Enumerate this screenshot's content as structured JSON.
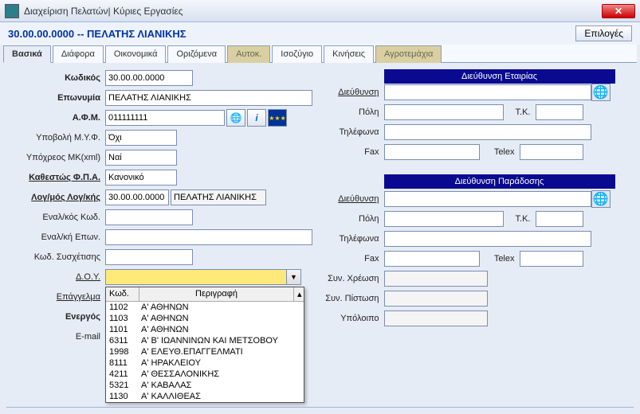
{
  "titlebar": {
    "text": "Διαχείριση Πελατών| Κύριες Εργασίες",
    "close": "✕"
  },
  "subheader": {
    "text": "30.00.00.0000 -- ΠΕΛΑΤΗΣ ΛΙΑΝΙΚΗΣ",
    "options": "Επιλογές"
  },
  "tabs": {
    "basic": "Βασικά",
    "misc": "Διάφορα",
    "finance": "Οικονομικά",
    "defs": "Οριζόμενα",
    "auto": "Αυτοκ.",
    "balance": "Ισοζύγιο",
    "moves": "Κινήσεις",
    "parcels": "Αγροτεμάχια"
  },
  "left": {
    "code_lbl": "Κωδικός",
    "code": "30.00.00.0000",
    "name_lbl": "Επωνυμία",
    "name": "ΠΕΛΑΤΗΣ ΛΙΑΝΙΚΗΣ",
    "afm_lbl": "Α.Φ.Μ.",
    "afm": "011111111",
    "myf_lbl": "Υποβολή Μ.Υ.Φ.",
    "myf": "Όχι",
    "mk_lbl": "Υπόχρεος MK(xml)",
    "mk": "Ναί",
    "vat_lbl": "Καθεστώς Φ.Π.Α.",
    "vat": "Κανονικό",
    "acct_lbl": "Λογ/μός Λογ/κής",
    "acct_code": "30.00.00.0000",
    "acct_name": "ΠΕΛΑΤΗΣ ΛΙΑΝΙΚΗΣ",
    "altcode_lbl": "Εναλ/κός Κωδ.",
    "altcode": "",
    "altname_lbl": "Εναλ/κή Επων.",
    "altname": "",
    "relation_lbl": "Κωδ. Συσχέτισης",
    "relation": "",
    "doy_lbl": "Δ.Ο.Υ.",
    "doy": "",
    "prof_lbl": "Επάγγελμα",
    "active_lbl": "Ενεργός",
    "email_lbl": "E-mail"
  },
  "right": {
    "company_hdr": "Διεύθυνση Εταιρίας",
    "addr_lbl": "Διεύθυνση",
    "addr": "",
    "city_lbl": "Πόλη",
    "city": "",
    "zip_lbl": "Τ.Κ.",
    "zip": "",
    "tel_lbl": "Τηλέφωνα",
    "tel": "",
    "fax_lbl": "Fax",
    "fax": "",
    "telex_lbl": "Telex",
    "telex": "",
    "delivery_hdr": "Διεύθυνση Παράδοσης",
    "daddr_lbl": "Διεύθυνση",
    "daddr": "",
    "dcity_lbl": "Πόλη",
    "dcity": "",
    "dzip_lbl": "Τ.Κ.",
    "dzip": "",
    "dtel_lbl": "Τηλέφωνα",
    "dtel": "",
    "dfax_lbl": "Fax",
    "dfax": "",
    "dtelex_lbl": "Telex",
    "dtelex": "",
    "debit_lbl": "Συν. Χρέωση",
    "debit": "",
    "credit_lbl": "Συν. Πίστωση",
    "credit": "",
    "balance_lbl": "Υπόλοιπο",
    "balance": ""
  },
  "dropdown": {
    "col1": "Κωδ.",
    "col2": "Περιγραφή",
    "rows": [
      {
        "code": "1102",
        "desc": "Α' ΑΘΗΝΩΝ"
      },
      {
        "code": "1103",
        "desc": "Α' ΑΘΗΝΩΝ"
      },
      {
        "code": "1101",
        "desc": "Α' ΑΘΗΝΩΝ"
      },
      {
        "code": "6311",
        "desc": "Α' Β' ΙΩΑΝΝΙΝΩΝ ΚΑΙ ΜΕΤΣΟΒΟΥ"
      },
      {
        "code": "1998",
        "desc": "Α' ΕΛΕΥΘ.ΕΠΑΓΓΕΛΜΑΤΙ"
      },
      {
        "code": "8111",
        "desc": "Α' ΗΡΑΚΛΕΙΟΥ"
      },
      {
        "code": "4211",
        "desc": "Α' ΘΕΣΣΑΛΟΝΙΚΗΣ"
      },
      {
        "code": "5321",
        "desc": "Α' ΚΑΒΑΛΑΣ"
      },
      {
        "code": "1130",
        "desc": "Α' ΚΑΛΛΙΘΕΑΣ"
      }
    ]
  }
}
